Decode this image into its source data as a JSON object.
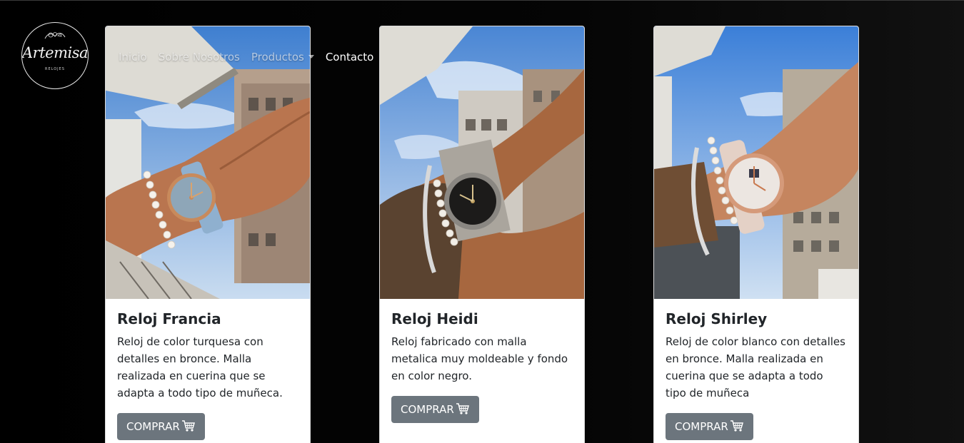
{
  "brand": {
    "name": "Artemisa",
    "subtitle": "RELOJES"
  },
  "nav": {
    "items": [
      {
        "label": "Inicio"
      },
      {
        "label": "Sobre Nosotros"
      },
      {
        "label": "Productos"
      },
      {
        "label": "Contacto"
      }
    ]
  },
  "products": [
    {
      "title": "Reloj Francia",
      "text": "Reloj de color turquesa con detalles en bronce. Malla realizada en cuerina que se adapta a todo tipo de muñeca.",
      "button": "COMPRAR"
    },
    {
      "title": "Reloj Heidi",
      "text": "Reloj fabricado con malla metalica muy moldeable y fondo en color negro.",
      "button": "COMPRAR"
    },
    {
      "title": "Reloj Shirley",
      "text": "Reloj de color blanco con detalles en bronce. Malla realizada en cuerina que se adapta a todo tipo de muñeca",
      "button": "COMPRAR"
    }
  ],
  "colors": {
    "button": "#6c757d",
    "background": "#000000"
  }
}
